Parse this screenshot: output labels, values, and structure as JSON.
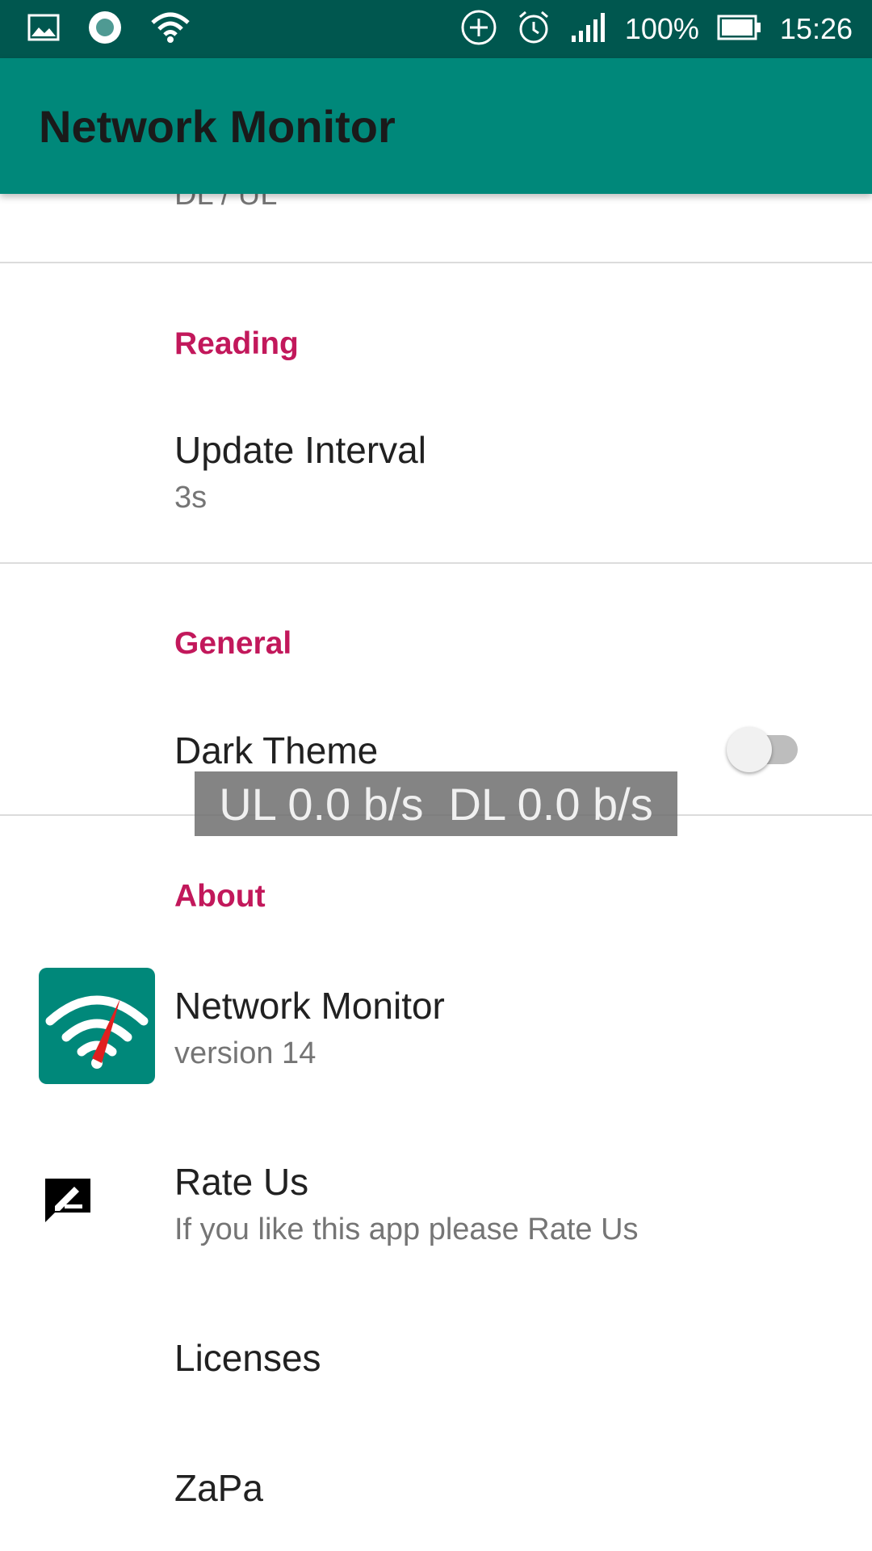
{
  "status_bar": {
    "battery": "100%",
    "time": "15:26"
  },
  "app_bar": {
    "title": "Network Monitor"
  },
  "partial_summary": "DL / UL",
  "reading": {
    "category": "Reading",
    "update_interval": {
      "title": "Update Interval",
      "summary": "3s"
    }
  },
  "general": {
    "category": "General",
    "dark_theme": {
      "title": "Dark Theme",
      "enabled": false
    }
  },
  "overlay_text": "UL 0.0 b/s  DL 0.0 b/s",
  "about": {
    "category": "About",
    "app": {
      "title": "Network Monitor",
      "summary": "version 14"
    },
    "rate": {
      "title": "Rate Us",
      "summary": "If you like this app please Rate Us"
    },
    "licenses": {
      "title": "Licenses"
    },
    "zapa": {
      "title": "ZaPa"
    }
  },
  "colors": {
    "status_bar": "#00574f",
    "app_bar": "#00887a",
    "category": "#c2185b"
  }
}
